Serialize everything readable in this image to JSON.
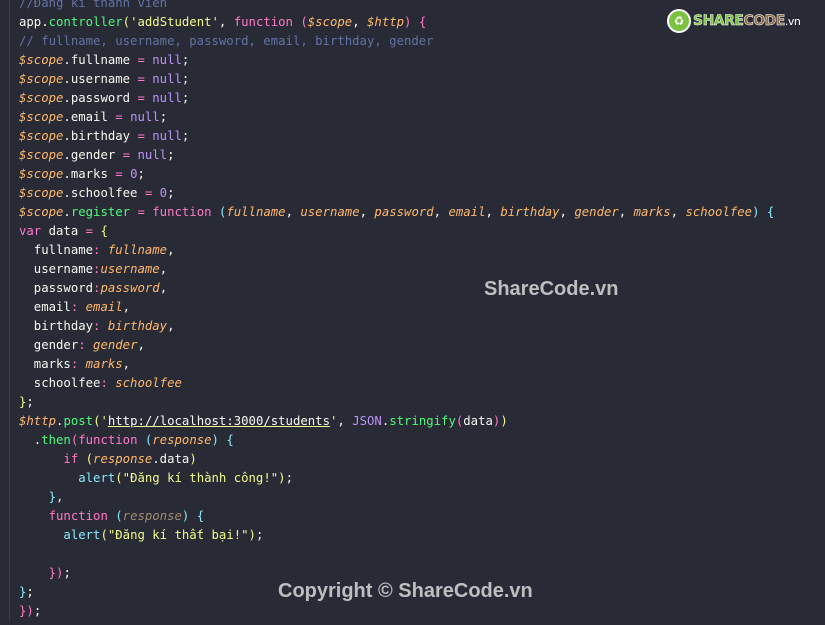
{
  "colors": {
    "background": "#282a36",
    "keyword": "#ff79c6",
    "function": "#50fa7b",
    "string": "#f1fa8c",
    "variable": "#ffb86c",
    "comment": "#6272a4",
    "constant": "#bd93f9"
  },
  "logo": {
    "text": "SHARECODE.vn",
    "icon": "recycle-logo-icon"
  },
  "watermark": "ShareCode.vn",
  "copyright": "Copyright © ShareCode.vn",
  "code_lines": [
    [
      [
        "com",
        "//Đăng kí thành viên"
      ]
    ],
    [
      [
        "plain",
        "app."
      ],
      [
        "fn",
        "controller"
      ],
      [
        "b1",
        "("
      ],
      [
        "str",
        "'addStudent'"
      ],
      [
        "plain",
        ", "
      ],
      [
        "kw",
        "function"
      ],
      [
        "plain",
        " "
      ],
      [
        "b2",
        "("
      ],
      [
        "var",
        "$scope"
      ],
      [
        "plain",
        ", "
      ],
      [
        "var",
        "$http"
      ],
      [
        "b2",
        ")"
      ],
      [
        "plain",
        " "
      ],
      [
        "b2",
        "{"
      ]
    ],
    [
      [
        "com",
        "// fullname, username, password, email, birthday, gender"
      ]
    ],
    [
      [
        "var",
        "$scope"
      ],
      [
        "plain",
        ".fullname "
      ],
      [
        "kw",
        "="
      ],
      [
        "plain",
        " "
      ],
      [
        "const",
        "null"
      ],
      [
        "plain",
        ";"
      ]
    ],
    [
      [
        "var",
        "$scope"
      ],
      [
        "plain",
        ".username "
      ],
      [
        "kw",
        "="
      ],
      [
        "plain",
        " "
      ],
      [
        "const",
        "null"
      ],
      [
        "plain",
        ";"
      ]
    ],
    [
      [
        "var",
        "$scope"
      ],
      [
        "plain",
        ".password "
      ],
      [
        "kw",
        "="
      ],
      [
        "plain",
        " "
      ],
      [
        "const",
        "null"
      ],
      [
        "plain",
        ";"
      ]
    ],
    [
      [
        "var",
        "$scope"
      ],
      [
        "plain",
        ".email "
      ],
      [
        "kw",
        "="
      ],
      [
        "plain",
        " "
      ],
      [
        "const",
        "null"
      ],
      [
        "plain",
        ";"
      ]
    ],
    [
      [
        "var",
        "$scope"
      ],
      [
        "plain",
        ".birthday "
      ],
      [
        "kw",
        "="
      ],
      [
        "plain",
        " "
      ],
      [
        "const",
        "null"
      ],
      [
        "plain",
        ";"
      ]
    ],
    [
      [
        "var",
        "$scope"
      ],
      [
        "plain",
        ".gender "
      ],
      [
        "kw",
        "="
      ],
      [
        "plain",
        " "
      ],
      [
        "const",
        "null"
      ],
      [
        "plain",
        ";"
      ]
    ],
    [
      [
        "var",
        "$scope"
      ],
      [
        "plain",
        ".marks "
      ],
      [
        "kw",
        "="
      ],
      [
        "plain",
        " "
      ],
      [
        "const",
        "0"
      ],
      [
        "plain",
        ";"
      ]
    ],
    [
      [
        "var",
        "$scope"
      ],
      [
        "plain",
        ".schoolfee "
      ],
      [
        "kw",
        "="
      ],
      [
        "plain",
        " "
      ],
      [
        "const",
        "0"
      ],
      [
        "plain",
        ";"
      ]
    ],
    [
      [
        "var",
        "$scope"
      ],
      [
        "plain",
        "."
      ],
      [
        "fn",
        "register"
      ],
      [
        "plain",
        " "
      ],
      [
        "kw",
        "="
      ],
      [
        "plain",
        " "
      ],
      [
        "kw",
        "function"
      ],
      [
        "plain",
        " "
      ],
      [
        "b3",
        "("
      ],
      [
        "param",
        "fullname"
      ],
      [
        "plain",
        ", "
      ],
      [
        "param",
        "username"
      ],
      [
        "plain",
        ", "
      ],
      [
        "param",
        "password"
      ],
      [
        "plain",
        ", "
      ],
      [
        "param",
        "email"
      ],
      [
        "plain",
        ", "
      ],
      [
        "param",
        "birthday"
      ],
      [
        "plain",
        ", "
      ],
      [
        "param",
        "gender"
      ],
      [
        "plain",
        ", "
      ],
      [
        "param",
        "marks"
      ],
      [
        "plain",
        ", "
      ],
      [
        "param",
        "schoolfee"
      ],
      [
        "b3",
        ")"
      ],
      [
        "plain",
        " "
      ],
      [
        "b3",
        "{"
      ]
    ],
    [
      [
        "kw",
        "var"
      ],
      [
        "plain",
        " data "
      ],
      [
        "kw",
        "="
      ],
      [
        "plain",
        " "
      ],
      [
        "b1",
        "{"
      ]
    ],
    [
      [
        "plain",
        "  fullname"
      ],
      [
        "kw",
        ":"
      ],
      [
        "plain",
        " "
      ],
      [
        "param",
        "fullname"
      ],
      [
        "plain",
        ","
      ]
    ],
    [
      [
        "plain",
        "  username"
      ],
      [
        "kw",
        ":"
      ],
      [
        "param",
        "username"
      ],
      [
        "plain",
        ","
      ]
    ],
    [
      [
        "plain",
        "  password"
      ],
      [
        "kw",
        ":"
      ],
      [
        "param",
        "password"
      ],
      [
        "plain",
        ","
      ]
    ],
    [
      [
        "plain",
        "  email"
      ],
      [
        "kw",
        ":"
      ],
      [
        "plain",
        " "
      ],
      [
        "param",
        "email"
      ],
      [
        "plain",
        ","
      ]
    ],
    [
      [
        "plain",
        "  birthday"
      ],
      [
        "kw",
        ":"
      ],
      [
        "plain",
        " "
      ],
      [
        "param",
        "birthday"
      ],
      [
        "plain",
        ","
      ]
    ],
    [
      [
        "plain",
        "  gender"
      ],
      [
        "kw",
        ":"
      ],
      [
        "plain",
        " "
      ],
      [
        "param",
        "gender"
      ],
      [
        "plain",
        ","
      ]
    ],
    [
      [
        "plain",
        "  marks"
      ],
      [
        "kw",
        ":"
      ],
      [
        "plain",
        " "
      ],
      [
        "param",
        "marks"
      ],
      [
        "plain",
        ","
      ]
    ],
    [
      [
        "plain",
        "  schoolfee"
      ],
      [
        "kw",
        ":"
      ],
      [
        "plain",
        " "
      ],
      [
        "param",
        "schoolfee"
      ]
    ],
    [
      [
        "b1",
        "}"
      ],
      [
        "plain",
        ";"
      ]
    ],
    [
      [
        "var",
        "$http"
      ],
      [
        "plain",
        "."
      ],
      [
        "fn",
        "post"
      ],
      [
        "b1",
        "("
      ],
      [
        "str",
        "'"
      ],
      [
        "url",
        "http://localhost:3000/students"
      ],
      [
        "str",
        "'"
      ],
      [
        "plain",
        ", "
      ],
      [
        "cls",
        "JSON"
      ],
      [
        "plain",
        "."
      ],
      [
        "fn",
        "stringify"
      ],
      [
        "b2",
        "("
      ],
      [
        "plain",
        "data"
      ],
      [
        "b2",
        ")"
      ],
      [
        "b1",
        ")"
      ]
    ],
    [
      [
        "plain",
        "  ."
      ],
      [
        "fn",
        "then"
      ],
      [
        "b2",
        "("
      ],
      [
        "kw",
        "function"
      ],
      [
        "plain",
        " "
      ],
      [
        "b3",
        "("
      ],
      [
        "param",
        "response"
      ],
      [
        "b3",
        ")"
      ],
      [
        "plain",
        " "
      ],
      [
        "b3",
        "{"
      ]
    ],
    [
      [
        "plain",
        "      "
      ],
      [
        "kw",
        "if"
      ],
      [
        "plain",
        " "
      ],
      [
        "b1",
        "("
      ],
      [
        "param",
        "response"
      ],
      [
        "plain",
        ".data"
      ],
      [
        "b1",
        ")"
      ]
    ],
    [
      [
        "plain",
        "        "
      ],
      [
        "call",
        "alert"
      ],
      [
        "b1",
        "("
      ],
      [
        "str",
        "\"Đăng kí thành công!\""
      ],
      [
        "b1",
        ")"
      ],
      [
        "plain",
        ";"
      ]
    ],
    [
      [
        "plain",
        "    "
      ],
      [
        "b3",
        "}"
      ],
      [
        "plain",
        ","
      ]
    ],
    [
      [
        "plain",
        "    "
      ],
      [
        "kw",
        "function"
      ],
      [
        "plain",
        " "
      ],
      [
        "b3",
        "("
      ],
      [
        "dim",
        "response"
      ],
      [
        "b3",
        ")"
      ],
      [
        "plain",
        " "
      ],
      [
        "b3",
        "{"
      ]
    ],
    [
      [
        "plain",
        "      "
      ],
      [
        "call",
        "alert"
      ],
      [
        "b1",
        "("
      ],
      [
        "str",
        "\"Đăng kí thất bại!\""
      ],
      [
        "b1",
        ")"
      ],
      [
        "plain",
        ";"
      ]
    ],
    [
      [
        "plain",
        ""
      ]
    ],
    [
      [
        "plain",
        "    "
      ],
      [
        "b2",
        "}"
      ],
      [
        "b2",
        ")"
      ],
      [
        "plain",
        ";"
      ]
    ],
    [
      [
        "b3",
        "}"
      ],
      [
        "plain",
        ";"
      ]
    ],
    [
      [
        "b2",
        "}"
      ],
      [
        "b2",
        ")"
      ],
      [
        "plain",
        ";"
      ]
    ]
  ]
}
